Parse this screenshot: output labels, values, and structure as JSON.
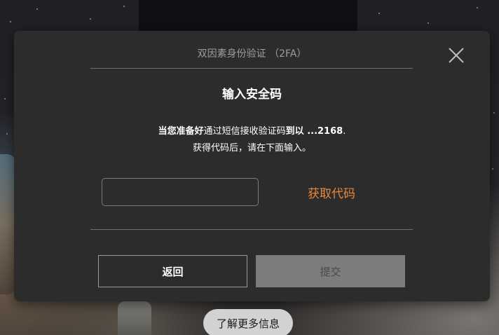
{
  "modal": {
    "header_title": "双因素身份验证 （2FA）",
    "close_icon": "close-icon",
    "heading": "输入安全码",
    "instruction": {
      "line1_part1": "当您准备好",
      "line1_part2": "通过短信接收验证码",
      "line1_part3": "到以 ...2168",
      "line1_part4": ".",
      "line2": "获得代码后，请在下面输入。"
    },
    "code_input": {
      "value": "",
      "placeholder": ""
    },
    "get_code_label": "获取代码",
    "back_label": "返回",
    "submit_label": "提交"
  },
  "more_info_label": "了解更多信息",
  "colors": {
    "modal_bg": "#2c2c2c",
    "accent": "#e8883a",
    "submit_disabled_bg": "#7c7c7c",
    "pill_bg": "#d2d2d2"
  }
}
